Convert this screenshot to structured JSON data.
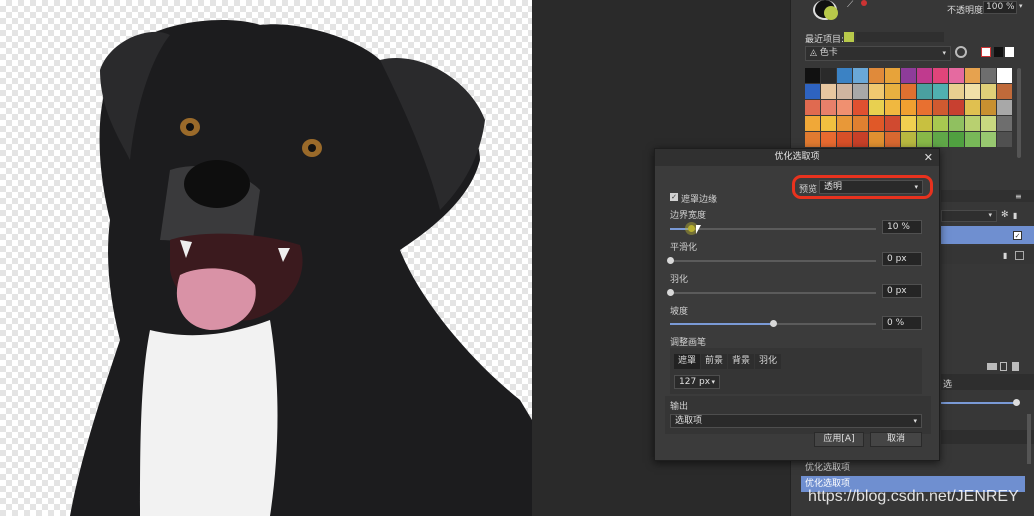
{
  "panel": {
    "opacity_label": "不透明度:",
    "opacity_value": "100 %",
    "recent_label": "最近项目:",
    "palette_name": "色卡",
    "swatches": [
      "#111111",
      "#2a2a2a",
      "#3b82c4",
      "#6aa8d8",
      "#e08a3a",
      "#e7a33a",
      "#8e3c9a",
      "#c03a8e",
      "#e0457a",
      "#e56aa0",
      "#e6a24f",
      "#6e6e6e",
      "#ffffff",
      "#2e63c0",
      "#e8c7a0",
      "#d0b5a0",
      "#a8a8a8",
      "#f0c870",
      "#e8b040",
      "#e07030",
      "#4aa0a0",
      "#50b0b0",
      "#e8d090",
      "#f0e0a8",
      "#e0d078",
      "#c06a3a",
      "#e06a50",
      "#e8806a",
      "#f09070",
      "#e05030",
      "#e8d050",
      "#f0b840",
      "#f0a030",
      "#e87030",
      "#d05a30",
      "#c84030",
      "#e0c050",
      "#c89030",
      "#a8a8a8",
      "#f0a838",
      "#f0c040",
      "#e89838",
      "#e08030",
      "#e05828",
      "#d04a30",
      "#f0d050",
      "#c8c040",
      "#a8c850",
      "#90c060",
      "#b8d070",
      "#c8d880",
      "#6e6e6e",
      "#e07a30",
      "#e86a30",
      "#d85028",
      "#c84028",
      "#e09030",
      "#d86830",
      "#b8b840",
      "#88b848",
      "#60a848",
      "#50a040",
      "#78b858",
      "#98c870",
      "#505050"
    ],
    "layers_items": [
      "优化选取项",
      "优化选取项"
    ],
    "adj_label": "选"
  },
  "dialog": {
    "title": "优化选取项",
    "preview_label": "预览",
    "preview_value": "透明",
    "mat_edges_label": "遮罩边缘",
    "border_width_label": "边界宽度",
    "border_width_value": "10 %",
    "border_width_level": 0.1,
    "smooth_label": "平滑化",
    "smooth_value": "0 px",
    "feather_label": "羽化",
    "feather_value": "0 px",
    "ramp_label": "坡度",
    "ramp_value": "0 %",
    "ramp_level": 0.5,
    "brush_label": "调整画笔",
    "brush_tabs": [
      "遮罩",
      "前景",
      "背景",
      "羽化"
    ],
    "brush_size": "127 px",
    "output_label": "输出",
    "output_value": "选取项",
    "apply_label": "应用[A]",
    "cancel_label": "取消"
  },
  "watermark": "https://blog.csdn.net/JENREY"
}
